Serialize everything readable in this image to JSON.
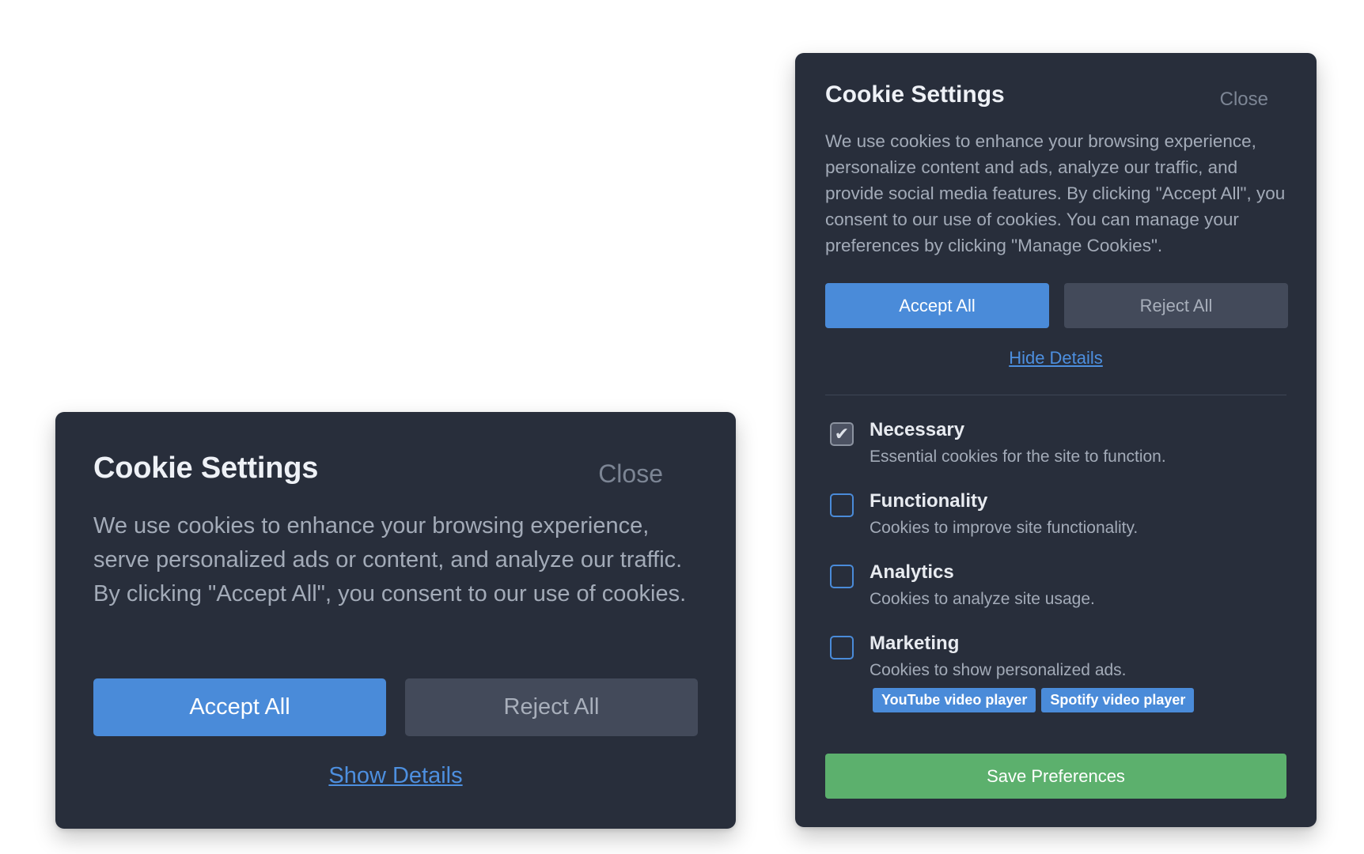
{
  "collapsed_dialog": {
    "title": "Cookie Settings",
    "close_label": "Close",
    "description": "We use cookies to enhance your browsing experience, serve personalized ads or content, and analyze our traffic. By clicking \"Accept All\", you consent to our use of cookies.",
    "accept_label": "Accept All",
    "reject_label": "Reject All",
    "details_link": "Show Details"
  },
  "expanded_dialog": {
    "title": "Cookie Settings",
    "close_label": "Close",
    "description": "We use cookies to enhance your browsing experience, personalize content and ads, analyze our traffic, and provide social media features. By clicking \"Accept All\", you consent to our use of cookies. You can manage your preferences by clicking \"Manage Cookies\".",
    "accept_label": "Accept All",
    "reject_label": "Reject All",
    "details_link": "Hide Details",
    "options": [
      {
        "title": "Necessary",
        "description": "Essential cookies for the site to function.",
        "checked": true,
        "disabled": true
      },
      {
        "title": "Functionality",
        "description": "Cookies to improve site functionality.",
        "checked": false
      },
      {
        "title": "Analytics",
        "description": "Cookies to analyze site usage.",
        "checked": false
      },
      {
        "title": "Marketing",
        "description": "Cookies to show personalized ads.",
        "checked": false,
        "tags": [
          "YouTube video player",
          "Spotify video player"
        ]
      }
    ],
    "save_label": "Save Preferences"
  },
  "colors": {
    "card_background": "#282e3b",
    "accent_blue": "#4a8bd9",
    "reject_button": "#434a5a",
    "save_green": "#5cb06d"
  },
  "icons": {
    "checked_checkbox": "checkmark-icon"
  }
}
